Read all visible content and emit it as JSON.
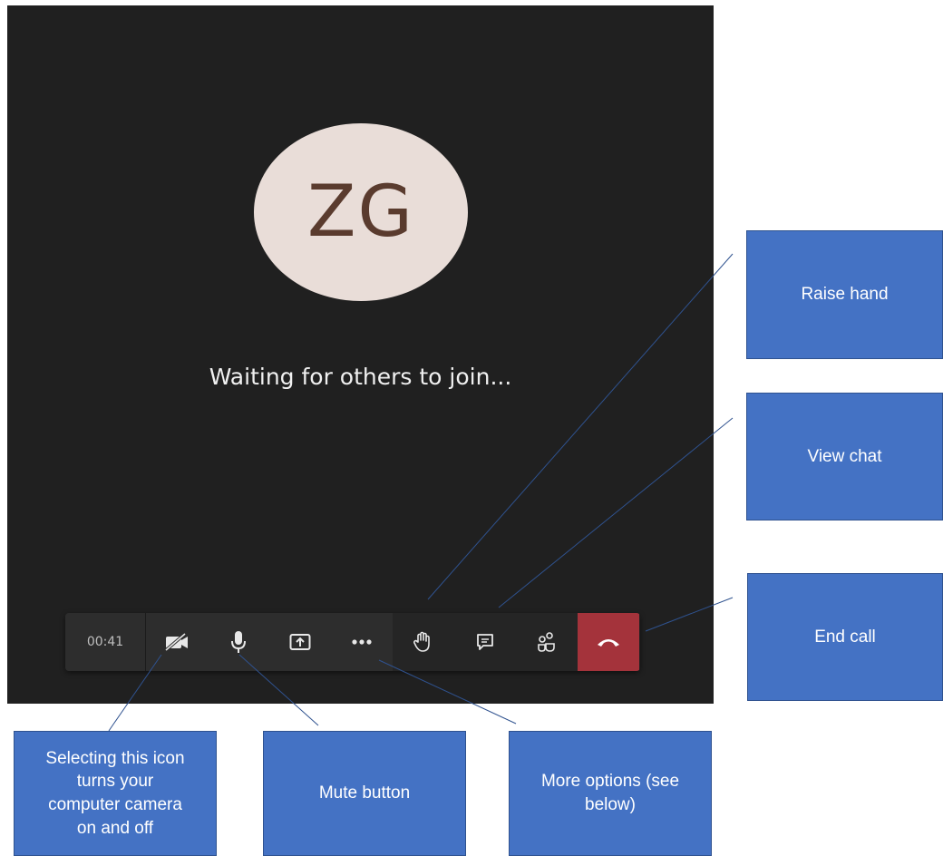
{
  "call": {
    "avatar_initials": "ZG",
    "status_text": "Waiting for others to join...",
    "timer": "00:41"
  },
  "toolbar": {
    "buttons": [
      {
        "name": "camera-toggle",
        "icon": "camera-off-icon"
      },
      {
        "name": "mute",
        "icon": "microphone-icon"
      },
      {
        "name": "share-screen",
        "icon": "share-screen-icon"
      },
      {
        "name": "more-options",
        "icon": "more-horizontal-icon"
      },
      {
        "name": "raise-hand",
        "icon": "hand-icon"
      },
      {
        "name": "chat",
        "icon": "chat-icon"
      },
      {
        "name": "participants",
        "icon": "participants-icon"
      },
      {
        "name": "end-call",
        "icon": "hang-up-icon"
      }
    ],
    "end_call_color": "#a4333b"
  },
  "callouts": {
    "raise_hand": "Raise hand",
    "view_chat": "View chat",
    "end_call": "End call",
    "camera_line1": "Selecting this icon",
    "camera_line2": "turns your",
    "camera_line3": "computer camera",
    "camera_line4": "on and off",
    "mute": "Mute button",
    "more_line1": "More options (see",
    "more_line2": "below)"
  },
  "colors": {
    "callout_fill": "#4472c4",
    "stage_bg": "#202020",
    "avatar_bg": "#e9ddd8"
  }
}
